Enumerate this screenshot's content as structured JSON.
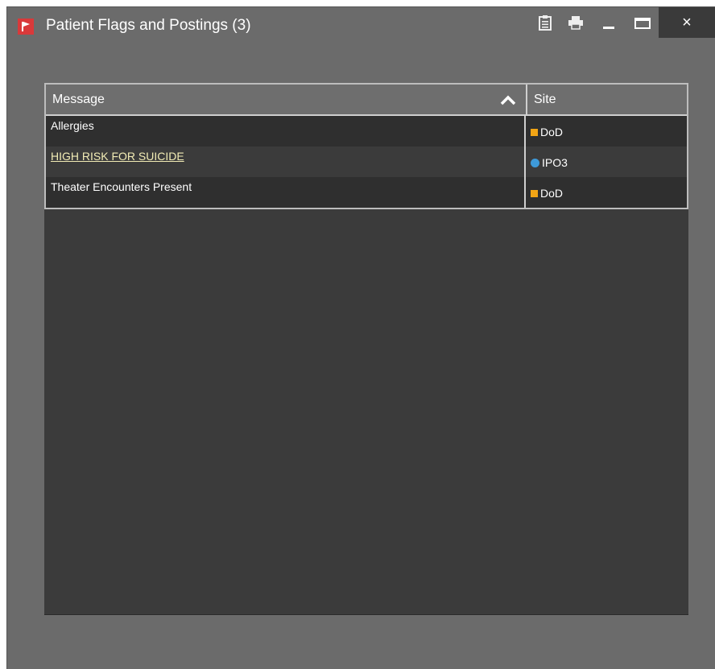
{
  "window": {
    "title": "Patient Flags and Postings (3)",
    "icons": {
      "app": "flag-icon",
      "clipboard": "clipboard-icon",
      "print": "printer-icon",
      "minimize": "minimize-icon",
      "maximize": "maximize-icon",
      "close": "close-icon"
    },
    "close_glyph": "×"
  },
  "grid": {
    "columns": [
      {
        "label": "Message",
        "sort": "ascending",
        "sort_icon": "chevron-up-icon"
      },
      {
        "label": "Site"
      }
    ],
    "rows": [
      {
        "message": "Allergies",
        "is_link": false,
        "site": "DoD",
        "site_marker": "square",
        "marker_color": "#f2a515"
      },
      {
        "message": "HIGH RISK FOR SUICIDE",
        "is_link": true,
        "site": "IPO3",
        "site_marker": "circle",
        "marker_color": "#3e9ad9"
      },
      {
        "message": "Theater Encounters Present",
        "is_link": false,
        "site": "DoD",
        "site_marker": "square",
        "marker_color": "#f2a515"
      }
    ]
  },
  "colors": {
    "window_bg": "#6b6b6b",
    "grid_bg": "#3b3b3b",
    "flag_red": "#d9393a",
    "link": "#f2ecb5"
  }
}
